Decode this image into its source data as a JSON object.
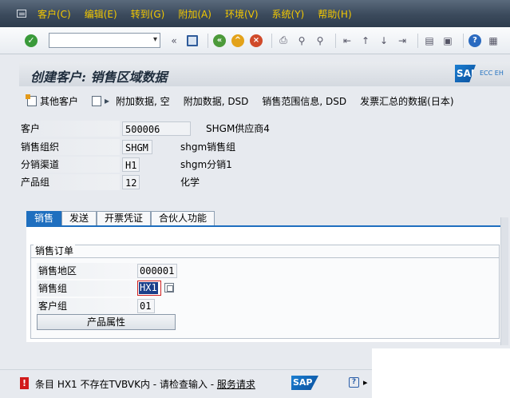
{
  "menubar": {
    "items": [
      "客户(C)",
      "编辑(E)",
      "转到(G)",
      "附加(A)",
      "环境(V)",
      "系统(Y)",
      "帮助(H)"
    ]
  },
  "toolbar": {
    "command_value": "",
    "collapse": "«",
    "icons": [
      "enter-icon",
      "save-icon",
      "back-icon",
      "exit-icon",
      "cancel-icon",
      "print-icon",
      "find-icon",
      "find-next-icon",
      "first-page-icon",
      "prev-page-icon",
      "next-page-icon",
      "last-page-icon",
      "new-session-icon",
      "shortcut-icon",
      "help-icon",
      "customize-icon"
    ]
  },
  "title": "创建客户: 销售区域数据",
  "sap_logo": {
    "text": "SAP",
    "edition": "ECC EH"
  },
  "apptoolbar": {
    "buttons": [
      "其他客户",
      "附加数据, 空",
      "附加数据, DSD",
      "销售范围信息, DSD",
      "发票汇总的数据(日本)"
    ]
  },
  "header": {
    "customer": {
      "label": "客户",
      "value": "500006",
      "desc": "SHGM供应商4"
    },
    "sales_org": {
      "label": "销售组织",
      "value": "SHGM",
      "desc": "shgm销售组"
    },
    "distr_channel": {
      "label": "分销渠道",
      "value": "H1",
      "desc": "shgm分销1"
    },
    "division": {
      "label": "产品组",
      "value": "12",
      "desc": "化学"
    }
  },
  "tabs": [
    "销售",
    "发送",
    "开票凭证",
    "合伙人功能"
  ],
  "sales_order": {
    "title": "销售订单",
    "sales_district": {
      "label": "销售地区",
      "value": "000001"
    },
    "sales_group": {
      "label": "销售组",
      "value": "HX1"
    },
    "customer_group": {
      "label": "客户组",
      "value": "01"
    },
    "product_attr_button": "产品属性"
  },
  "status": {
    "type": "error",
    "message": "条目 HX1 不存在TVBVK内 - 请检查输入 - ",
    "link": "服务请求",
    "logo": "SAP"
  },
  "colors": {
    "menu_text": "#f3c800",
    "tab_active": "#1f6fbf",
    "error": "#d11a1a"
  }
}
